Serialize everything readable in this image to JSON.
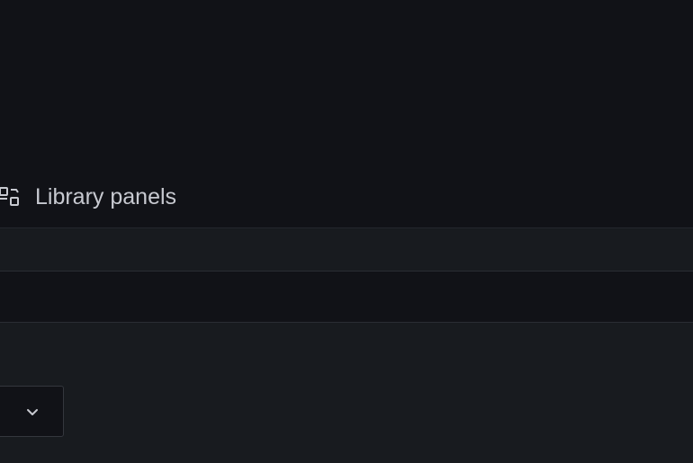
{
  "nav": {
    "library_panels": {
      "label": "Library panels",
      "icon": "library-panels-icon"
    }
  },
  "dropdown": {
    "icon": "chevron-down-icon"
  },
  "colors": {
    "background": "#111217",
    "panel": "#181b1f",
    "border": "#2a2d33",
    "text": "#c7c9d0"
  }
}
